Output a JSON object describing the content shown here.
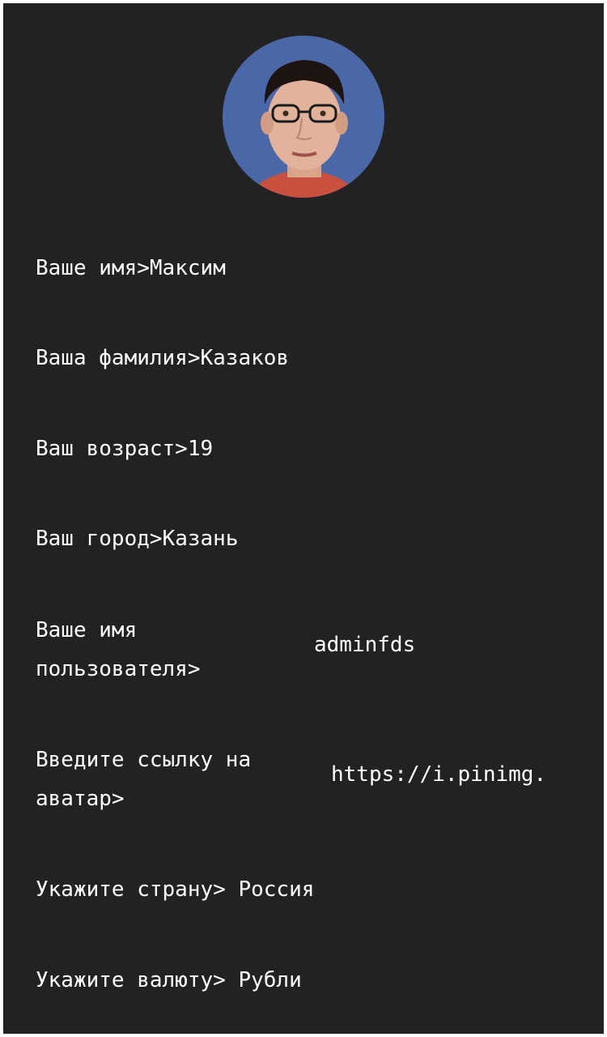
{
  "profile": {
    "avatar_icon": "user-avatar-photo",
    "fields": [
      {
        "label": "Ваше имя>",
        "value": "Максим"
      },
      {
        "label": "Ваша фамилия>",
        "value": "Казаков"
      },
      {
        "label": "Ваш возраст>",
        "value": "19"
      },
      {
        "label": "Ваш город>",
        "value": "Казань"
      },
      {
        "label": "Ваше имя\nпользователя>",
        "value": "adminfds"
      },
      {
        "label": "Введите ссылку на\nаватар>",
        "value": "https://i.pinimg."
      },
      {
        "label": "Укажите страну>",
        "value": "Россия"
      },
      {
        "label": "Укажите валюту>",
        "value": "Рубли"
      }
    ]
  },
  "colors": {
    "background": "#222222",
    "text": "#ffffff",
    "avatar_bg": "#4a67a8"
  }
}
